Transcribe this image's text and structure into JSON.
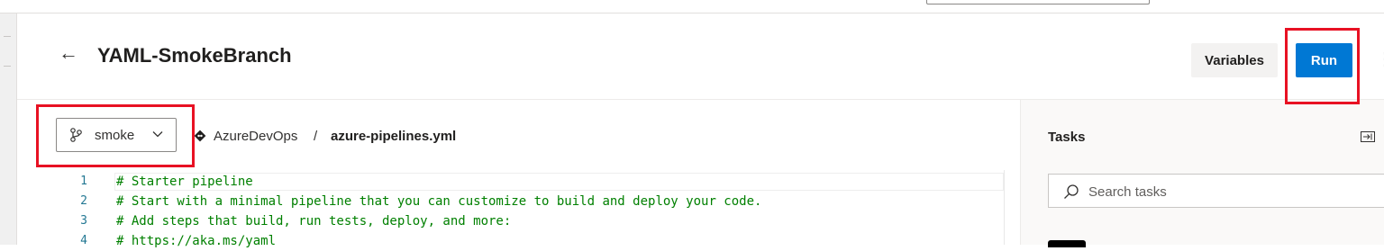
{
  "header": {
    "back_icon": "arrow-left-icon",
    "title": "YAML-SmokeBranch",
    "variables_label": "Variables",
    "run_label": "Run",
    "more_icon": "more-vertical-icon"
  },
  "editor": {
    "branch": {
      "icon": "git-branch-icon",
      "label": "smoke"
    },
    "repo": {
      "icon": "repo-icon",
      "name": "AzureDevOps",
      "separator": "/",
      "file": "azure-pipelines.yml"
    },
    "lines": [
      {
        "num": "1",
        "text": "# Starter pipeline"
      },
      {
        "num": "2",
        "text": "# Start with a minimal pipeline that you can customize to build and deploy your code."
      },
      {
        "num": "3",
        "text": "# Add steps that build, run tests, deploy, and more:"
      },
      {
        "num": "4",
        "text": "# https://aka.ms/yaml"
      }
    ]
  },
  "tasks": {
    "title": "Tasks",
    "search_placeholder": "Search tasks"
  },
  "colors": {
    "accent": "#0078d4",
    "highlight": "#e81123",
    "comment": "#008000",
    "line_number": "#237893"
  }
}
